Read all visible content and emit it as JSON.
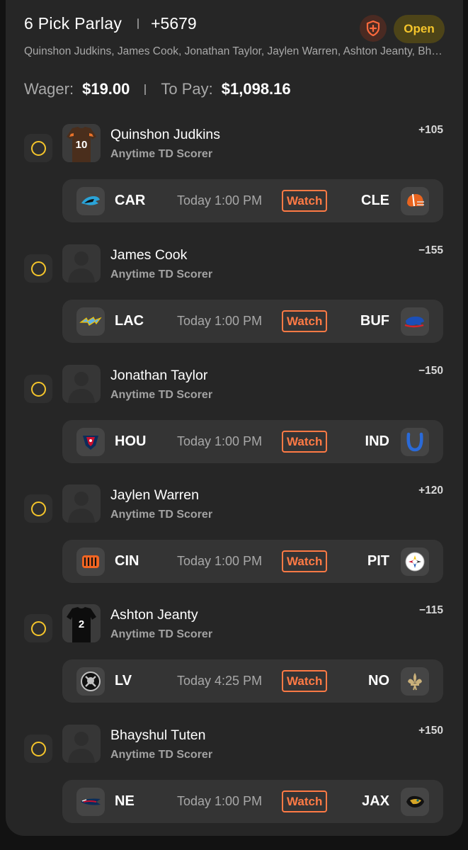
{
  "header": {
    "title": "6 Pick Parlay",
    "odds": "+5679",
    "status_badge": "Open",
    "players_summary": "Quinshon Judkins, James Cook, Jonathan Taylor, Jaylen Warren, Ashton Jeanty, Bhayshul Tuten",
    "wager_label": "Wager:",
    "wager_value": "$19.00",
    "payout_label": "To Pay:",
    "payout_value": "$1,098.16"
  },
  "icons": {
    "radio": "radio-unchecked-icon",
    "shield": "shield-plus-icon",
    "avatar_placeholder": "person-silhouette-icon"
  },
  "colors": {
    "accent_yellow": "#f5c52b",
    "watch_orange": "#ff7a45",
    "card_bg": "#262626"
  },
  "legs": [
    {
      "player": "Quinshon Judkins",
      "market": "Anytime TD Scorer",
      "odds": "+105",
      "avatar": "browns-jersey-10",
      "game": {
        "away": "CAR",
        "time": "Today 1:00 PM",
        "watch": "Watch",
        "home": "CLE",
        "away_logo": "panthers-logo-icon",
        "home_logo": "browns-helmet-icon"
      }
    },
    {
      "player": "James Cook",
      "market": "Anytime TD Scorer",
      "odds": "−155",
      "avatar": "placeholder",
      "game": {
        "away": "LAC",
        "time": "Today 1:00 PM",
        "watch": "Watch",
        "home": "BUF",
        "away_logo": "chargers-bolt-icon",
        "home_logo": "bills-buffalo-icon"
      }
    },
    {
      "player": "Jonathan Taylor",
      "market": "Anytime TD Scorer",
      "odds": "−150",
      "avatar": "placeholder",
      "game": {
        "away": "HOU",
        "time": "Today 1:00 PM",
        "watch": "Watch",
        "home": "IND",
        "away_logo": "texans-bull-icon",
        "home_logo": "colts-horseshoe-icon"
      }
    },
    {
      "player": "Jaylen Warren",
      "market": "Anytime TD Scorer",
      "odds": "+120",
      "avatar": "placeholder",
      "game": {
        "away": "CIN",
        "time": "Today 1:00 PM",
        "watch": "Watch",
        "home": "PIT",
        "away_logo": "bengals-b-icon",
        "home_logo": "steelers-logo-icon"
      }
    },
    {
      "player": "Ashton Jeanty",
      "market": "Anytime TD Scorer",
      "odds": "−115",
      "avatar": "raiders-jersey-2",
      "game": {
        "away": "LV",
        "time": "Today 4:25 PM",
        "watch": "Watch",
        "home": "NO",
        "away_logo": "raiders-shield-icon",
        "home_logo": "saints-fleur-de-lis-icon"
      }
    },
    {
      "player": "Bhayshul Tuten",
      "market": "Anytime TD Scorer",
      "odds": "+150",
      "avatar": "placeholder",
      "game": {
        "away": "NE",
        "time": "Today 1:00 PM",
        "watch": "Watch",
        "home": "JAX",
        "away_logo": "patriots-logo-icon",
        "home_logo": "jaguars-head-icon"
      }
    }
  ]
}
